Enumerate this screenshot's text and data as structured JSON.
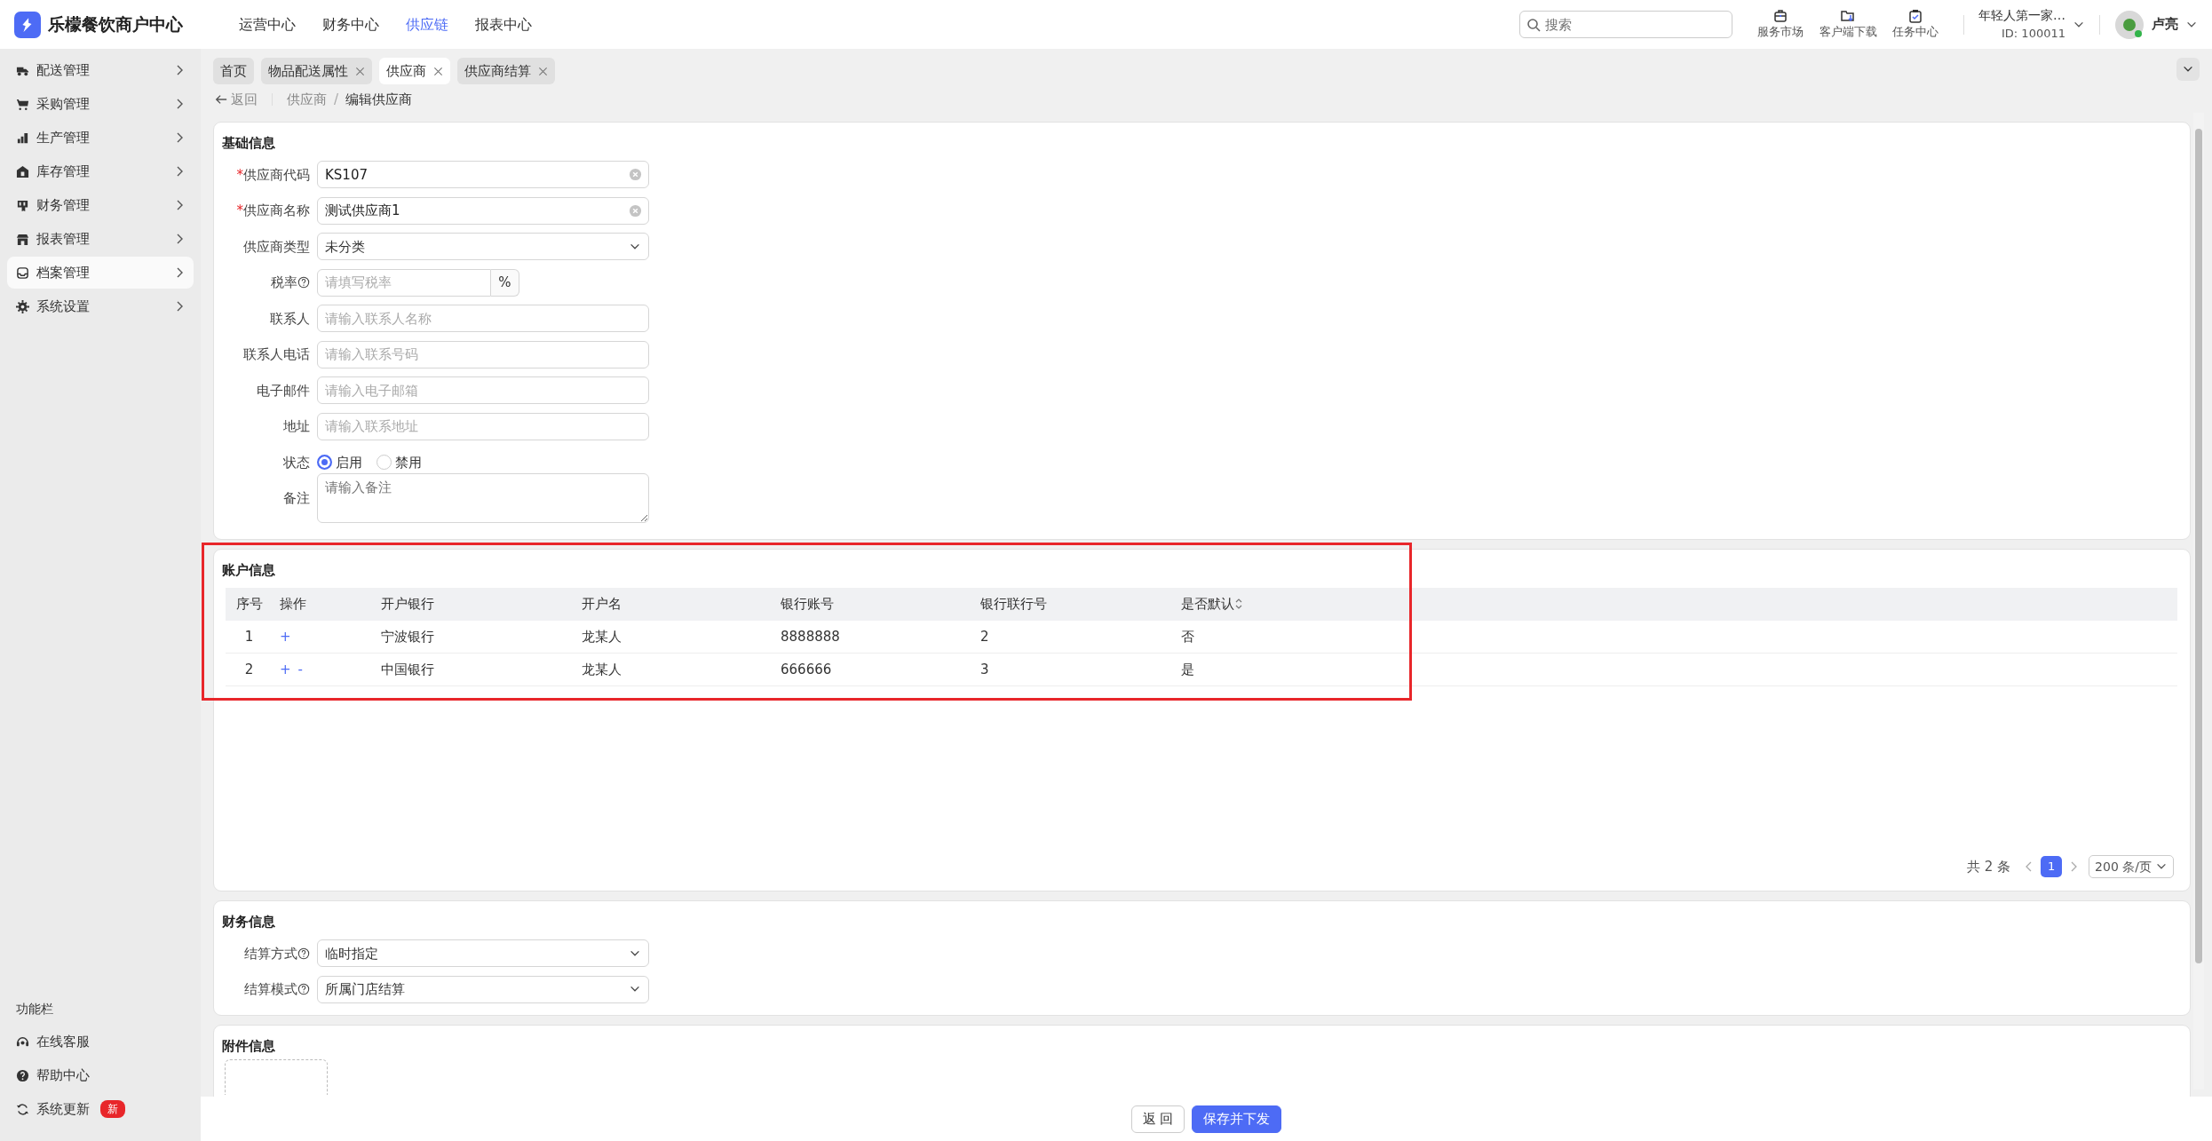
{
  "app": {
    "name": "乐檬餐饮商户中心"
  },
  "top_nav": [
    {
      "label": "运营中心",
      "selected": false
    },
    {
      "label": "财务中心",
      "selected": false
    },
    {
      "label": "供应链",
      "selected": true
    },
    {
      "label": "报表中心",
      "selected": false
    }
  ],
  "search": {
    "placeholder": "搜索"
  },
  "tools": [
    {
      "kind": "market",
      "label": "服务市场"
    },
    {
      "kind": "download",
      "label": "客户端下载"
    },
    {
      "kind": "task",
      "label": "任务中心"
    }
  ],
  "account": {
    "name": "年轻人第一家…",
    "id": "ID: 100011"
  },
  "user": {
    "name": "卢亮"
  },
  "sidebar": {
    "items": [
      {
        "kind": "truck",
        "label": "配送管理",
        "selected": false
      },
      {
        "kind": "cart",
        "label": "采购管理",
        "selected": false
      },
      {
        "kind": "chart",
        "label": "生产管理",
        "selected": false
      },
      {
        "kind": "house",
        "label": "库存管理",
        "selected": false
      },
      {
        "kind": "receipt",
        "label": "财务管理",
        "selected": false
      },
      {
        "kind": "store",
        "label": "报表管理",
        "selected": false
      },
      {
        "kind": "inbox",
        "label": "档案管理",
        "selected": true
      },
      {
        "kind": "gear",
        "label": "系统设置",
        "selected": false
      }
    ],
    "footer_title": "功能栏",
    "footer_items": [
      {
        "kind": "headset",
        "label": "在线客服"
      },
      {
        "kind": "help",
        "label": "帮助中心"
      },
      {
        "kind": "refresh",
        "label": "系统更新",
        "badge": "新"
      }
    ]
  },
  "tabs": [
    {
      "label": "首页",
      "closable": false,
      "selected": false
    },
    {
      "label": "物品配送属性",
      "closable": true,
      "selected": false
    },
    {
      "label": "供应商",
      "closable": true,
      "selected": true
    },
    {
      "label": "供应商结算",
      "closable": true,
      "selected": false
    }
  ],
  "breadcrumb": {
    "back": "返回",
    "separator": "/",
    "items": [
      "供应商",
      "编辑供应商"
    ]
  },
  "basic": {
    "title": "基础信息",
    "required_mark": "*",
    "fields": [
      {
        "kind": "text",
        "label": "供应商代码",
        "required": true,
        "value": "KS107",
        "clearable": true
      },
      {
        "kind": "text",
        "label": "供应商名称",
        "required": true,
        "value": "测试供应商1",
        "clearable": true
      },
      {
        "kind": "select",
        "label": "供应商类型",
        "value": "未分类"
      },
      {
        "kind": "addon",
        "label": "税率",
        "help": true,
        "placeholder": "请填写税率",
        "addon": "%"
      },
      {
        "kind": "text",
        "label": "联系人",
        "placeholder": "请输入联系人名称"
      },
      {
        "kind": "text",
        "label": "联系人电话",
        "placeholder": "请输入联系号码"
      },
      {
        "kind": "text",
        "label": "电子邮件",
        "placeholder": "请输入电子邮箱"
      },
      {
        "kind": "text",
        "label": "地址",
        "placeholder": "请输入联系地址"
      },
      {
        "kind": "radio",
        "label": "状态",
        "options": [
          {
            "label": "启用",
            "selected": true
          },
          {
            "label": "禁用",
            "selected": false
          }
        ]
      },
      {
        "kind": "textarea",
        "label": "备注",
        "placeholder": "请输入备注"
      }
    ]
  },
  "accounts": {
    "title": "账户信息",
    "columns": [
      {
        "label": "序号"
      },
      {
        "label": "操作"
      },
      {
        "label": "开户银行"
      },
      {
        "label": "开户名"
      },
      {
        "label": "银行账号"
      },
      {
        "label": "银行联行号"
      },
      {
        "label": "是否默认",
        "sortable": true
      }
    ],
    "rows": [
      {
        "cells": [
          "1",
          [
            "+"
          ],
          "宁波银行",
          "龙某人",
          "8888888",
          "2",
          "否"
        ]
      },
      {
        "cells": [
          "2",
          [
            "+",
            "-"
          ],
          "中国银行",
          "龙某人",
          "666666",
          "3",
          "是"
        ]
      }
    ],
    "pagination": {
      "total": "共 2 条",
      "pages": [
        {
          "label": "1",
          "selected": true
        }
      ],
      "page_size": "200 条/页"
    }
  },
  "finance": {
    "title": "财务信息",
    "fields": [
      {
        "kind": "select",
        "label": "结算方式",
        "help": true,
        "value": "临时指定"
      },
      {
        "kind": "select",
        "label": "结算模式",
        "help": true,
        "value": "所属门店结算"
      }
    ]
  },
  "attachments": {
    "title": "附件信息"
  },
  "footer": {
    "buttons": [
      {
        "label": "返 回",
        "kind": "default"
      },
      {
        "label": "保存并下发",
        "kind": "primary"
      }
    ]
  }
}
